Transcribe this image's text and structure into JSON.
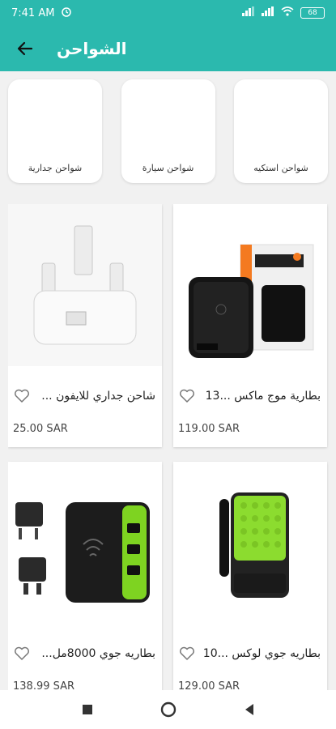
{
  "status_bar": {
    "time": "7:41 AM",
    "battery": "68"
  },
  "header": {
    "title": "الشواحن"
  },
  "categories": [
    {
      "label": "شواحن استكيه"
    },
    {
      "label": "شواحن سيارة"
    },
    {
      "label": "شواحن جدارية"
    }
  ],
  "products": [
    {
      "name": "بطارية موج ماكس ...13",
      "price": "119.00 SAR",
      "icon": "power-bank-image"
    },
    {
      "name": "شاحن جداري للايفون ...",
      "price": "25.00 SAR",
      "icon": "wall-charger-image"
    },
    {
      "name": "بطاريه جوي لوكس ...10",
      "price": "129.00 SAR",
      "icon": "green-power-bank-image"
    },
    {
      "name": "بطاريه جوي 8000مل...",
      "price": "138.99 SAR",
      "icon": "travel-power-bank-image"
    }
  ],
  "colors": {
    "accent": "#2bb9ae",
    "background": "#f1f1f1",
    "card": "#ffffff",
    "green": "#7ed321"
  }
}
